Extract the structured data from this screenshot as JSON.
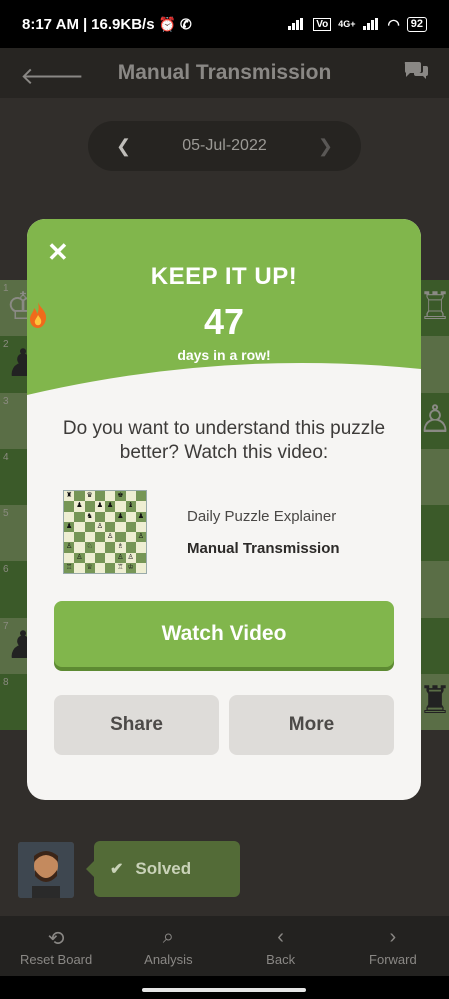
{
  "status_bar": {
    "time": "8:17 AM",
    "speed": "16.9KB/s",
    "network": "4G+",
    "battery": "92"
  },
  "header": {
    "title": "Manual Transmission"
  },
  "date_selector": {
    "date": "05-Jul-2022"
  },
  "board": {
    "ranks": [
      "1",
      "2",
      "3",
      "4",
      "5",
      "6",
      "7",
      "8"
    ]
  },
  "modal": {
    "heading": "KEEP IT UP!",
    "streak_count": "47",
    "streak_label": "days in a row!",
    "question": "Do you want to understand this puzzle better? Watch this video:",
    "video_subtitle": "Daily Puzzle Explainer",
    "video_title": "Manual Transmission",
    "watch_label": "Watch Video",
    "share_label": "Share",
    "more_label": "More",
    "accent_color": "#81b64c"
  },
  "solved_badge": {
    "label": "Solved"
  },
  "bottom_nav": [
    {
      "label": "Reset Board",
      "icon": "reset-icon"
    },
    {
      "label": "Analysis",
      "icon": "analysis-icon"
    },
    {
      "label": "Back",
      "icon": "chevron-left-icon"
    },
    {
      "label": "Forward",
      "icon": "chevron-right-icon"
    }
  ]
}
